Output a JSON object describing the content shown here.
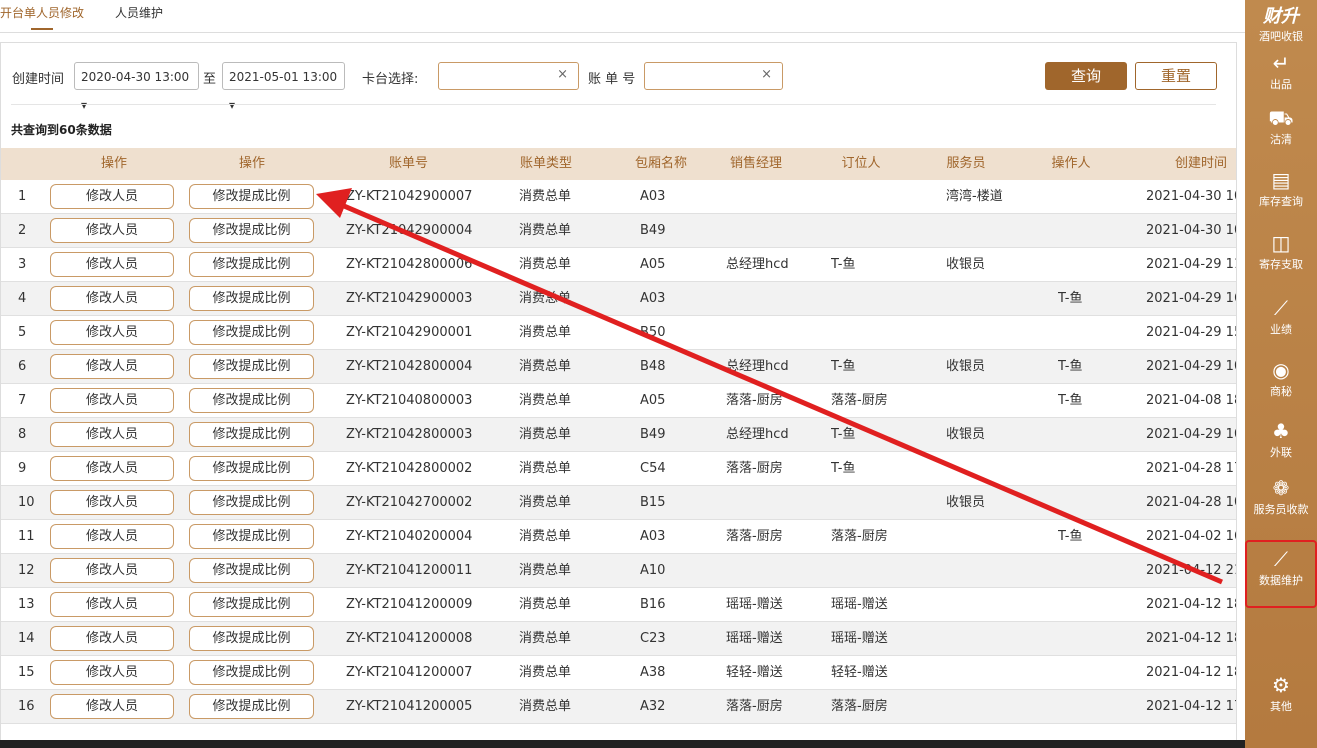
{
  "tabs": [
    "开台单人员修改",
    "人员维护"
  ],
  "filters": {
    "created_label": "创建时间",
    "start_date": "2020-04-30 13:00 ▾",
    "to_label": "至",
    "end_date": "2021-05-01 13:00 ▾",
    "table_label": "卡台选择:",
    "bill_label": "账 单 号",
    "clear_icon": "×",
    "query_button": "查询",
    "reset_button": "重置"
  },
  "summary": "共查询到60条数据",
  "columns": [
    "操作",
    "操作",
    "账单号",
    "账单类型",
    "包厢名称",
    "销售经理",
    "订位人",
    "服务员",
    "操作人",
    "创建时间"
  ],
  "row_buttons": {
    "edit_staff": "修改人员",
    "edit_ratio": "修改提成比例"
  },
  "rows": [
    {
      "no": "1",
      "bill": "ZY-KT21042900007",
      "type": "消费总单",
      "room": "A03",
      "manager": "",
      "booker": "",
      "waiter": "湾湾-楼道",
      "operator": "",
      "created": "2021-04-30 10"
    },
    {
      "no": "2",
      "bill": "ZY-KT21042900004",
      "type": "消费总单",
      "room": "B49",
      "manager": "",
      "booker": "",
      "waiter": "",
      "operator": "",
      "created": "2021-04-30 10"
    },
    {
      "no": "3",
      "bill": "ZY-KT21042800006",
      "type": "消费总单",
      "room": "A05",
      "manager": "总经理hcd",
      "booker": "T-鱼",
      "waiter": "收银员",
      "operator": "",
      "created": "2021-04-29 11"
    },
    {
      "no": "4",
      "bill": "ZY-KT21042900003",
      "type": "消费总单",
      "room": "A03",
      "manager": "",
      "booker": "",
      "waiter": "",
      "operator": "T-鱼",
      "created": "2021-04-29 16"
    },
    {
      "no": "5",
      "bill": "ZY-KT21042900001",
      "type": "消费总单",
      "room": "B50",
      "manager": "",
      "booker": "",
      "waiter": "",
      "operator": "",
      "created": "2021-04-29 15"
    },
    {
      "no": "6",
      "bill": "ZY-KT21042800004",
      "type": "消费总单",
      "room": "B48",
      "manager": "总经理hcd",
      "booker": "T-鱼",
      "waiter": "收银员",
      "operator": "T-鱼",
      "created": "2021-04-29 10"
    },
    {
      "no": "7",
      "bill": "ZY-KT21040800003",
      "type": "消费总单",
      "room": "A05",
      "manager": "落落-厨房",
      "booker": "落落-厨房",
      "waiter": "",
      "operator": "T-鱼",
      "created": "2021-04-08 18"
    },
    {
      "no": "8",
      "bill": "ZY-KT21042800003",
      "type": "消费总单",
      "room": "B49",
      "manager": "总经理hcd",
      "booker": "T-鱼",
      "waiter": "收银员",
      "operator": "",
      "created": "2021-04-29 10"
    },
    {
      "no": "9",
      "bill": "ZY-KT21042800002",
      "type": "消费总单",
      "room": "C54",
      "manager": "落落-厨房",
      "booker": "T-鱼",
      "waiter": "",
      "operator": "",
      "created": "2021-04-28 17"
    },
    {
      "no": "10",
      "bill": "ZY-KT21042700002",
      "type": "消费总单",
      "room": "B15",
      "manager": "",
      "booker": "",
      "waiter": "收银员",
      "operator": "",
      "created": "2021-04-28 10"
    },
    {
      "no": "11",
      "bill": "ZY-KT21040200004",
      "type": "消费总单",
      "room": "A03",
      "manager": "落落-厨房",
      "booker": "落落-厨房",
      "waiter": "",
      "operator": "T-鱼",
      "created": "2021-04-02 16"
    },
    {
      "no": "12",
      "bill": "ZY-KT21041200011",
      "type": "消费总单",
      "room": "A10",
      "manager": "",
      "booker": "",
      "waiter": "",
      "operator": "",
      "created": "2021-04-12 21"
    },
    {
      "no": "13",
      "bill": "ZY-KT21041200009",
      "type": "消费总单",
      "room": "B16",
      "manager": "瑶瑶-赠送",
      "booker": "瑶瑶-赠送",
      "waiter": "",
      "operator": "",
      "created": "2021-04-12 18"
    },
    {
      "no": "14",
      "bill": "ZY-KT21041200008",
      "type": "消费总单",
      "room": "C23",
      "manager": "瑶瑶-赠送",
      "booker": "瑶瑶-赠送",
      "waiter": "",
      "operator": "",
      "created": "2021-04-12 18"
    },
    {
      "no": "15",
      "bill": "ZY-KT21041200007",
      "type": "消费总单",
      "room": "A38",
      "manager": "轻轻-赠送",
      "booker": "轻轻-赠送",
      "waiter": "",
      "operator": "",
      "created": "2021-04-12 18"
    },
    {
      "no": "16",
      "bill": "ZY-KT21041200005",
      "type": "消费总单",
      "room": "A32",
      "manager": "落落-厨房",
      "booker": "落落-厨房",
      "waiter": "",
      "operator": "",
      "created": "2021-04-12 17"
    }
  ],
  "sidebar": {
    "brand": "财升",
    "brand_sub": "酒吧收银",
    "items": [
      {
        "label": "出品",
        "icon": "logout-icon",
        "glyph": "↵"
      },
      {
        "label": "沽清",
        "icon": "cart-icon",
        "glyph": "⛟"
      },
      {
        "label": "库存查询",
        "icon": "inventory-icon",
        "glyph": "▤"
      },
      {
        "label": "寄存支取",
        "icon": "storage-icon",
        "glyph": "◫"
      },
      {
        "label": "业绩",
        "icon": "trend-icon",
        "glyph": "⟋"
      },
      {
        "label": "商秘",
        "icon": "secretary-icon",
        "glyph": "◉"
      },
      {
        "label": "外联",
        "icon": "contacts-icon",
        "glyph": "♣"
      },
      {
        "label": "服务员收款",
        "icon": "payment-icon",
        "glyph": "❁"
      },
      {
        "label": "数据维护",
        "icon": "chart-icon",
        "glyph": "⟋"
      },
      {
        "label": "其他",
        "icon": "settings-icon",
        "glyph": "⚙"
      }
    ]
  },
  "annotation": {
    "color": "#e02020"
  }
}
